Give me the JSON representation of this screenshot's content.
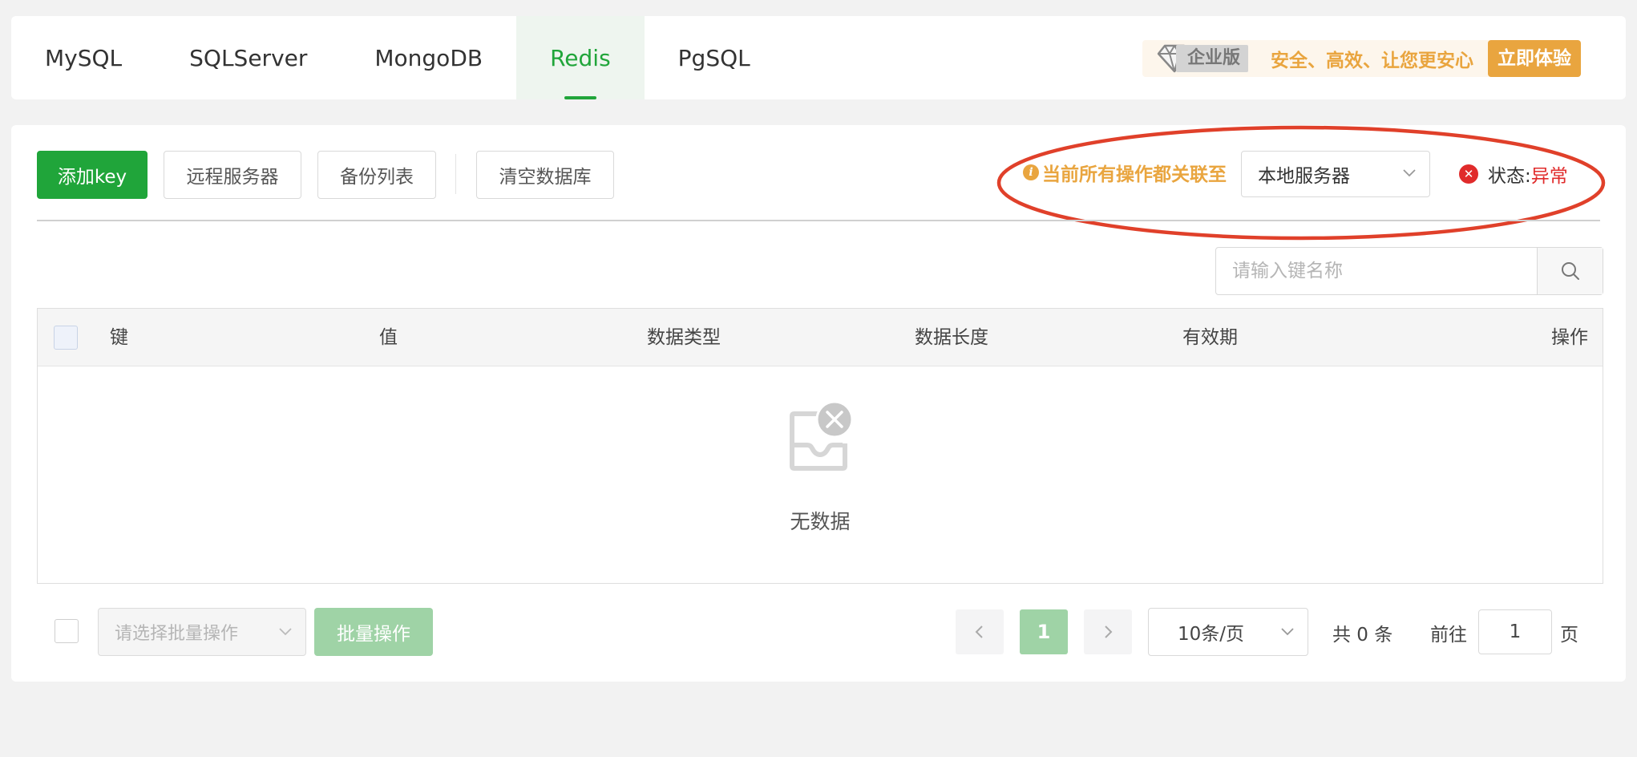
{
  "tabs": [
    {
      "label": "MySQL",
      "active": false
    },
    {
      "label": "SQLServer",
      "active": false
    },
    {
      "label": "MongoDB",
      "active": false
    },
    {
      "label": "Redis",
      "active": true
    },
    {
      "label": "PgSQL",
      "active": false
    }
  ],
  "promo": {
    "edition_label": "企业版",
    "slogan": "安全、高效、让您更安心",
    "try_button": "立即体验"
  },
  "toolbar": {
    "add_key": "添加key",
    "remote_server": "远程服务器",
    "backup_list": "备份列表",
    "clear_db": "清空数据库",
    "notice": "当前所有操作都关联至",
    "server_selected": "本地服务器",
    "status_label": "状态:",
    "status_value": "异常"
  },
  "search": {
    "placeholder": "请输入键名称",
    "value": ""
  },
  "table": {
    "columns": [
      "键",
      "值",
      "数据类型",
      "数据长度",
      "有效期",
      "操作"
    ],
    "rows": [],
    "empty_text": "无数据"
  },
  "footer": {
    "batch_placeholder": "请选择批量操作",
    "batch_button": "批量操作",
    "current_page": "1",
    "page_size": "10条/页",
    "total": "共 0 条",
    "goto_label": "前往",
    "goto_value": "1",
    "goto_suffix": "页"
  },
  "colors": {
    "primary": "#20a53a",
    "warning": "#e9a53f",
    "danger": "#e02b2b",
    "annotation": "#e0402a"
  }
}
